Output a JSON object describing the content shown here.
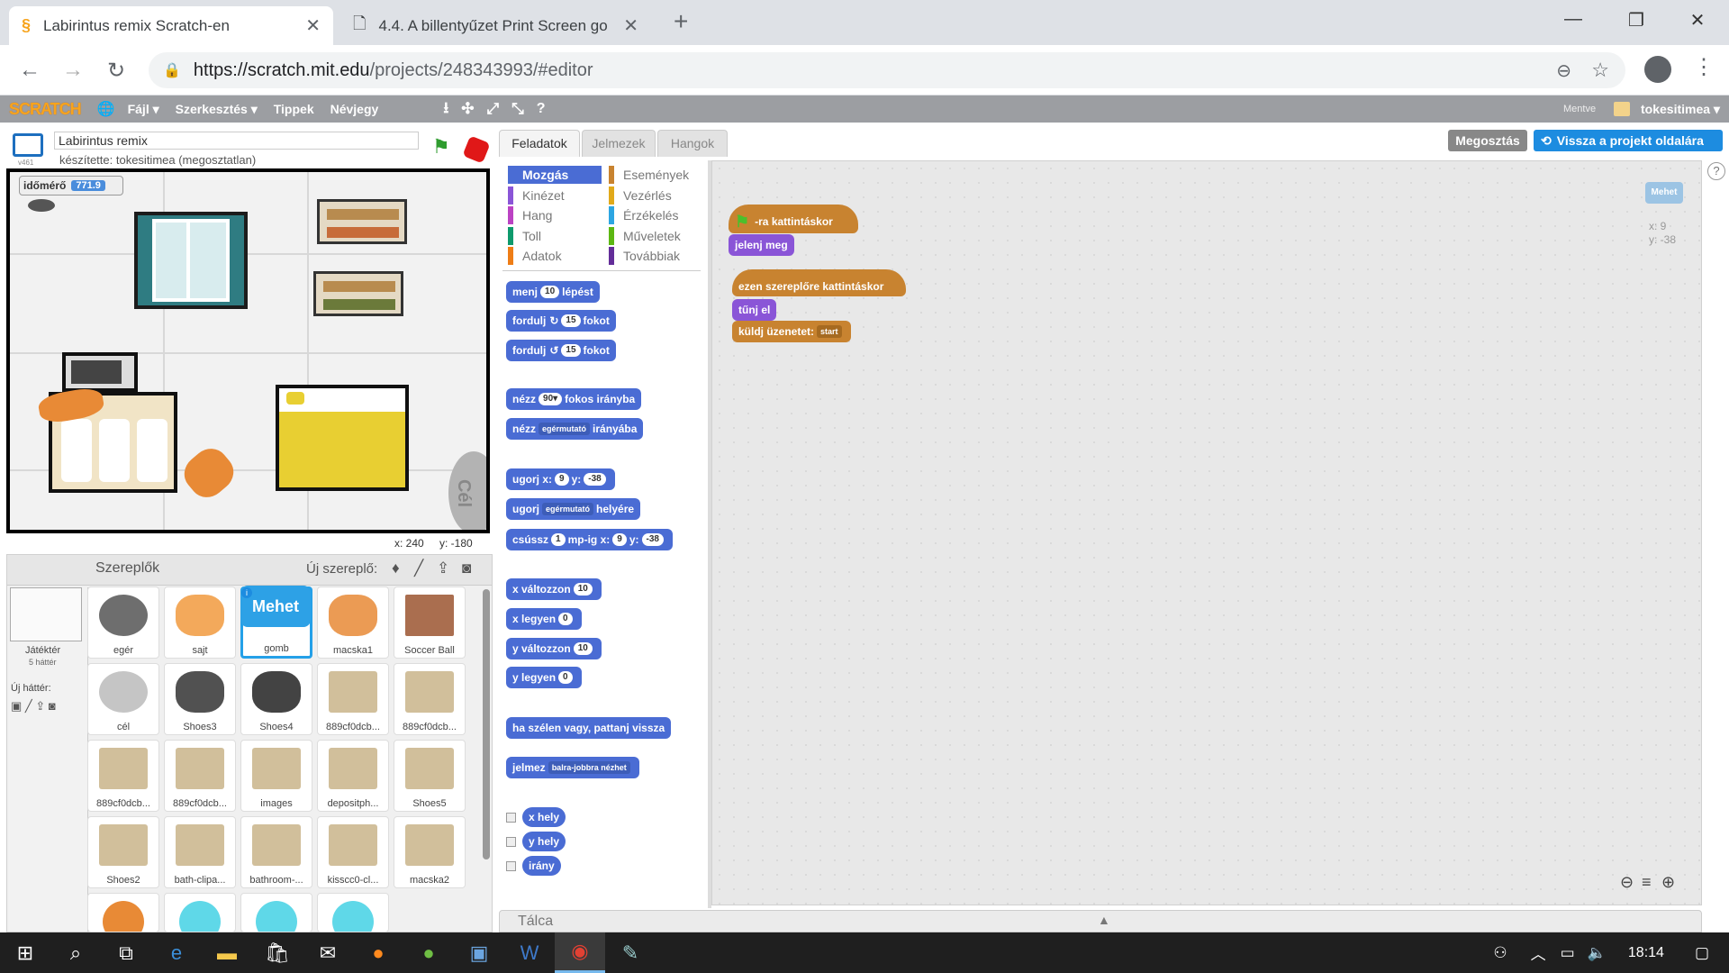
{
  "browser": {
    "tabs": [
      {
        "title": "Labirintus remix Scratch-en",
        "active": true
      },
      {
        "title": "4.4. A billentyűzet Print Screen go",
        "active": false
      }
    ],
    "new_tab": "+",
    "url_host": "https://scratch.mit.edu",
    "url_path": "/projects/248343993/#editor",
    "window_controls": [
      "—",
      "❐",
      "✕"
    ]
  },
  "menubar": {
    "logo": "SCRATCH",
    "items": [
      "Fájl ▾",
      "Szerkesztés ▾",
      "Tippek",
      "Névjegy"
    ],
    "saved_text": "Mentve",
    "user": "tokesitimea ▾"
  },
  "project": {
    "version": "v461",
    "title_value": "Labirintus remix",
    "author": "készítette: tokesitimea (megosztatlan)"
  },
  "stage": {
    "timer_label": "időmérő",
    "timer_value": "771.9",
    "cel_label": "Cél",
    "coords_x": "x: 240",
    "coords_y": "y: -180"
  },
  "editor_tabs": [
    "Feladatok",
    "Jelmezek",
    "Hangok"
  ],
  "top_buttons": {
    "share": "Megosztás",
    "back": "Vissza a projekt oldalára"
  },
  "categories": {
    "left": [
      {
        "name": "Mozgás",
        "color": "#4a6cd4",
        "selected": true
      },
      {
        "name": "Kinézet",
        "color": "#8a55d7"
      },
      {
        "name": "Hang",
        "color": "#bb42c3"
      },
      {
        "name": "Toll",
        "color": "#0e9a6c"
      },
      {
        "name": "Adatok",
        "color": "#ee7d16"
      }
    ],
    "right": [
      {
        "name": "Események",
        "color": "#c88330"
      },
      {
        "name": "Vezérlés",
        "color": "#e1a91a"
      },
      {
        "name": "Érzékelés",
        "color": "#2ca5e2"
      },
      {
        "name": "Műveletek",
        "color": "#5cb712"
      },
      {
        "name": "Továbbiak",
        "color": "#632d99"
      }
    ]
  },
  "palette": {
    "move": [
      "menj",
      "10",
      "lépést"
    ],
    "turn_r": [
      "fordulj",
      "↻",
      "15",
      "fokot"
    ],
    "turn_l": [
      "fordulj",
      "↺",
      "15",
      "fokot"
    ],
    "point_dir": [
      "nézz",
      "90▾",
      "fokos irányba"
    ],
    "point_to": [
      "nézz",
      "egérmutató",
      "irányába"
    ],
    "goto_xy": [
      "ugorj x:",
      "9",
      "y:",
      "-38"
    ],
    "goto": [
      "ugorj",
      "egérmutató",
      "helyére"
    ],
    "glide": [
      "csússz",
      "1",
      "mp-ig x:",
      "9",
      "y:",
      "-38"
    ],
    "change_x": [
      "x változzon",
      "10"
    ],
    "set_x": [
      "x legyen",
      "0"
    ],
    "change_y": [
      "y változzon",
      "10"
    ],
    "set_y": [
      "y legyen",
      "0"
    ],
    "bounce": "ha szélen vagy, pattanj vissza",
    "rotation": [
      "jelmez",
      "balra-jobbra nézhet"
    ],
    "reporters": [
      "x hely",
      "y hely",
      "irány"
    ]
  },
  "scripts": {
    "s1_hat": "-ra kattintáskor",
    "s1_b1": "jelenj meg",
    "s2_hat": "ezen szereplőre kattintáskor",
    "s2_b1": "tűnj el",
    "s2_b2": "küldj üzenetet:",
    "s2_b2_val": "start",
    "sprite_badge": "Mehet",
    "sprite_x": "x: 9",
    "sprite_y": "y: -38"
  },
  "sprites_panel": {
    "header": "Szereplők",
    "new_sprite": "Új szereplő:",
    "stage_label": "Játéktér",
    "stage_sub": "5 háttér",
    "new_backdrop": "Új háttér:",
    "items": [
      "egér",
      "sajt",
      "gomb",
      "macska1",
      "Soccer Ball",
      "cél",
      "Shoes3",
      "Shoes4",
      "889cf0dcb...",
      "889cf0dcb...",
      "889cf0dcb...",
      "889cf0dcb...",
      "images",
      "depositph...",
      "Shoes5",
      "Shoes2",
      "bath-clipa...",
      "bathroom-...",
      "kisscc0-cl...",
      "macska2"
    ],
    "gomb_text": "Mehet"
  },
  "backpack": "Tálca",
  "taskbar": {
    "time": "18:14"
  }
}
